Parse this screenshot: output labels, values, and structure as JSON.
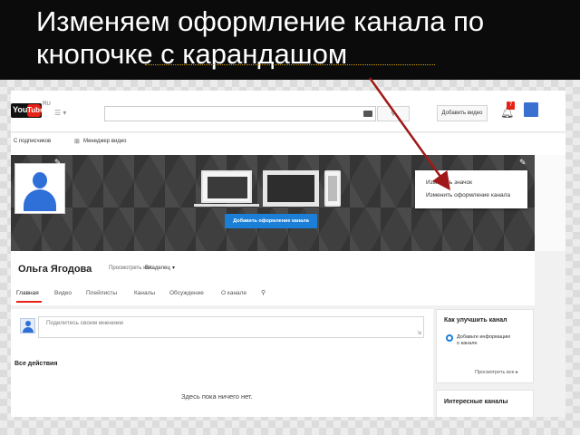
{
  "slide": {
    "title_line1": "Изменяем оформление канала по",
    "title_line2": "кнопочке с карандашом"
  },
  "masthead": {
    "logo_you": "You",
    "logo_tube": "Tube",
    "logo_region": "RU",
    "guide_icon": "guide-menu-icon",
    "search_placeholder": "",
    "search_button_icon": "search-icon",
    "upload_button_label": "Добавить видео",
    "notifications_icon": "bell-icon",
    "notifications_count": "7",
    "accent_color": "#e62117"
  },
  "subnav": {
    "subscriptions_label": "С подписчиков",
    "video_manager_label": "Менеджер видео"
  },
  "channel_header": {
    "edit_icon": "pencil-icon",
    "add_art_button_label": "Добавить оформление канала",
    "menu": {
      "item_1": "Изменить значок",
      "item_2": "Изменить оформление канала"
    },
    "button_color": "#1b7fd8"
  },
  "channel": {
    "name": "Ольга Ягодова",
    "view_as_label": "Просмотреть как:",
    "view_as_value": "Владелец",
    "tabs": [
      "Главная",
      "Видео",
      "Плейлисты",
      "Каналы",
      "Обсуждение",
      "О канале"
    ],
    "active_tab": "Главная"
  },
  "main": {
    "share_placeholder": "Поделитесь своим мнением",
    "all_activity_label": "Все действия",
    "empty_message": "Здесь пока ничего нет."
  },
  "sidebar": {
    "improve_title": "Как улучшить канал",
    "improve_item": "Добавьте информацию о канале",
    "improve_more": "Просмотреть все",
    "interesting_title": "Интересные каналы"
  },
  "annotation": {
    "arrow_color": "#a01818"
  }
}
